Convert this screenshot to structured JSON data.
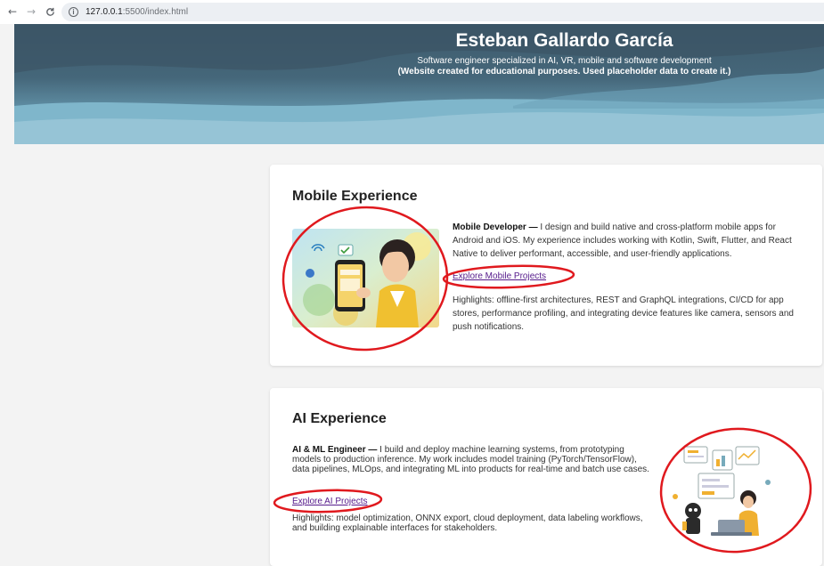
{
  "browser": {
    "back_icon": "arrow-left-icon",
    "forward_icon": "arrow-right-icon",
    "reload_icon": "reload-icon",
    "site_info_icon": "info-icon",
    "url_host": "127.0.0.1",
    "url_path": ":5500/index.html"
  },
  "hero": {
    "title": "Esteban Gallardo García",
    "subtitle": "Software engineer specialized in AI, VR, mobile and software development",
    "note": "(Website created for educational purposes. Used placeholder data to create it.)"
  },
  "mobile": {
    "heading": "Mobile Experience",
    "role": "Mobile Developer —",
    "description": " I design and build native and cross-platform mobile apps for Android and iOS. My experience includes working with Kotlin, Swift, Flutter, and React Native to deliver performant, accessible, and user-friendly applications.",
    "link": "Explore Mobile Projects",
    "highlights": "Highlights: offline-first architectures, REST and GraphQL integrations, CI/CD for app stores, performance profiling, and integrating device features like camera, sensors and push notifications."
  },
  "ai": {
    "heading": "AI Experience",
    "role": "AI & ML Engineer —",
    "description": " I build and deploy machine learning systems, from prototyping models to production inference. My work includes model training (PyTorch/TensorFlow), data pipelines, MLOps, and integrating ML into products for real-time and batch use cases.",
    "link": "Explore AI Projects",
    "highlights": "Highlights: model optimization, ONNX export, cloud deployment, data labeling workflows, and building explainable interfaces for stakeholders."
  },
  "colors": {
    "annotation": "#e0191e",
    "link": "#551a8b",
    "hero_dark": "#3e5a6c"
  }
}
